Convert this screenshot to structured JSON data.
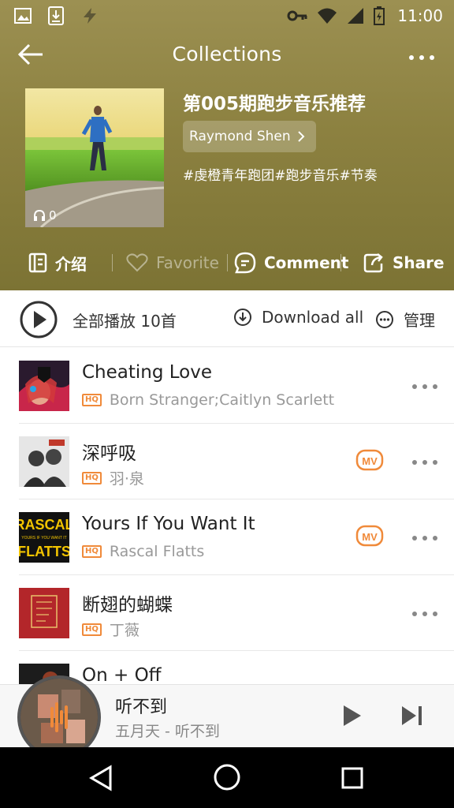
{
  "status_bar": {
    "time": "11:00",
    "icons": [
      "image-icon",
      "download-icon",
      "flash-icon",
      "key-icon",
      "wifi-icon",
      "signal-icon",
      "battery-icon"
    ]
  },
  "app_bar": {
    "title": "Collections"
  },
  "playlist": {
    "title": "第005期跑步音乐推荐",
    "author": "Raymond Shen",
    "tags": "#虔橙青年跑团#跑步音乐#节奏",
    "play_count": "0"
  },
  "actions": {
    "intro": "介绍",
    "favorite": "Favorite",
    "comment": "Comment",
    "share": "Share"
  },
  "toolbar": {
    "play_all": "全部播放 10首",
    "download_all": "Download all",
    "manage": "管理"
  },
  "songs": [
    {
      "title": "Cheating Love",
      "artist": "Born Stranger;Caitlyn Scarlett",
      "quality": "HQ",
      "has_mv": false
    },
    {
      "title": "深呼吸",
      "artist": "羽·泉",
      "quality": "HQ",
      "has_mv": true
    },
    {
      "title": "Yours If You Want It",
      "artist": "Rascal Flatts",
      "quality": "HQ",
      "has_mv": true
    },
    {
      "title": "断翅的蝴蝶",
      "artist": "丁薇",
      "quality": "HQ",
      "has_mv": false
    },
    {
      "title": "On + Off",
      "artist": "",
      "quality": "",
      "has_mv": false
    }
  ],
  "mv_label": "MV",
  "cover3_text": {
    "line1": "RASCAL",
    "line2": "FLATTS",
    "mid": "YOURS IF YOU WANT IT"
  },
  "now_playing": {
    "title": "听不到",
    "subtitle": "五月天 - 听不到"
  },
  "colors": {
    "accent": "#f08a3a",
    "header": "#8c8140"
  }
}
